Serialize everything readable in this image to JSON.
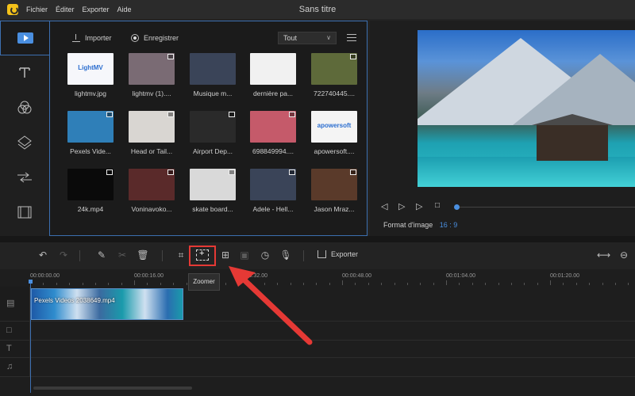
{
  "app": {
    "title": "Sans titre"
  },
  "menu": [
    "Fichier",
    "Éditer",
    "Exporter",
    "Aide"
  ],
  "rail": {
    "items": [
      "media",
      "text",
      "filters",
      "overlays",
      "transitions",
      "elements"
    ]
  },
  "media": {
    "import_label": "Importer",
    "record_label": "Enregistrer",
    "filter_value": "Tout",
    "tiles": [
      {
        "label": "lightmv.jpg",
        "color": "#f6f7fb",
        "text": "LightMV"
      },
      {
        "label": "lightmv (1)....",
        "color": "#7a6b74"
      },
      {
        "label": "Musique m...",
        "color": "#3a4458"
      },
      {
        "label": "dernière pa...",
        "color": "#f1f1f1"
      },
      {
        "label": "722740445....",
        "color": "#5e6a3a"
      },
      {
        "label": "Pexels Vide...",
        "color": "#2f7fb8"
      },
      {
        "label": "Head or Tail...",
        "color": "#d9d6d2"
      },
      {
        "label": "Airport Dep...",
        "color": "#2a2a2a"
      },
      {
        "label": "698849994....",
        "color": "#c55a6a"
      },
      {
        "label": "apowersoft....",
        "color": "#f4f4f4",
        "text": "apowersoft"
      },
      {
        "label": "24k.mp4",
        "color": "#0a0a0a"
      },
      {
        "label": "Voninavoko...",
        "color": "#5a2a2a"
      },
      {
        "label": "skate board...",
        "color": "#d9d9d9"
      },
      {
        "label": "Adele - Hell...",
        "color": "#3a4458"
      },
      {
        "label": "Jason Mraz...",
        "color": "#5a3a2a"
      }
    ]
  },
  "preview": {
    "aspect_label": "Format d'image",
    "aspect_value": "16 : 9"
  },
  "toolbar": {
    "export_label": "Exporter",
    "tooltip": "Zoomer"
  },
  "timeline": {
    "ticks": [
      "00:00:00.00",
      "00:00:16.00",
      "00:00:32.00",
      "00:00:48.00",
      "00:01:04.00",
      "00:01:20.00"
    ],
    "clip_label": "Pexels Videos 2038649.mp4"
  },
  "colors": {
    "accent": "#4a8fe0",
    "highlight": "#e53935"
  }
}
